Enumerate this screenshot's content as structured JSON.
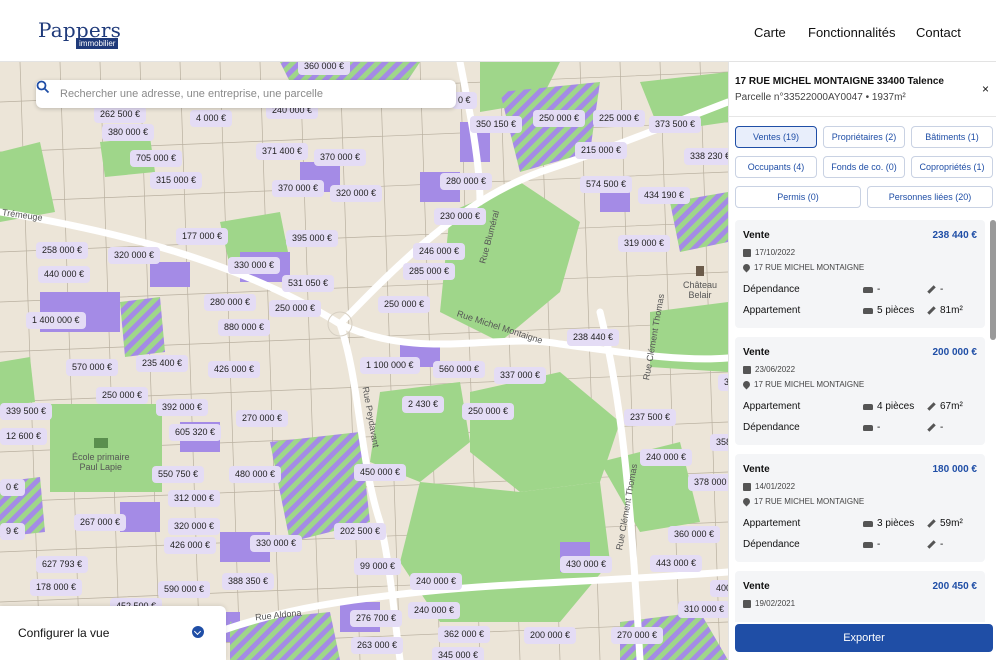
{
  "header": {
    "logo_main": "Pappers",
    "logo_sub": "immobilier",
    "nav": [
      {
        "label": "Carte"
      },
      {
        "label": "Fonctionnalités"
      },
      {
        "label": "Contact"
      }
    ]
  },
  "map": {
    "search_placeholder": "Rechercher une adresse, une entreprise, une parcelle",
    "configure_label": "Configurer la vue",
    "place_labels": [
      {
        "text": "École primaire\nPaul Lapie"
      },
      {
        "text": "Château Belair"
      }
    ],
    "street_labels": [
      {
        "text": "Rue Michel Montaigne"
      },
      {
        "text": "Rue Aldona"
      },
      {
        "text": "Rue Bluméral"
      },
      {
        "text": "Rue Clément Thomas"
      },
      {
        "text": "Rue Peydavant"
      },
      {
        "text": "Trémeuge"
      }
    ],
    "prices": [
      "360 000 €",
      "262 500 €",
      "240 000 €",
      "4 000 €",
      "380 000 €",
      "350 150 €",
      "250 000 €",
      "225 000 €",
      "373 500 €",
      "705 000 €",
      "371 400 €",
      "370 000 €",
      "215 000 €",
      "338 230 €",
      "315 000 €",
      "280 000 €",
      "574 500 €",
      "370 000 €",
      "320 000 €",
      "434 190 €",
      "230 000 €",
      "177 000 €",
      "395 000 €",
      "258 000 €",
      "320 000 €",
      "330 000 €",
      "246 000 €",
      "319 000 €",
      "440 000 €",
      "285 000 €",
      "531 050 €",
      "250 000 €",
      "280 000 €",
      "250 000 €",
      "1 400 000 €",
      "880 000 €",
      "238 440 €",
      "1 100 000 €",
      "570 000 €",
      "235 400 €",
      "426 000 €",
      "560 000 €",
      "337 000 €",
      "250 000 €",
      "392 000 €",
      "2 430 €",
      "250 000 €",
      "339 500 €",
      "270 000 €",
      "237 500 €",
      "12 600 €",
      "605 320 €",
      "240 000 €",
      "550 750 €",
      "480 000 €",
      "450 000 €",
      "378 000 €",
      "312 000 €",
      "267 000 €",
      "320 000 €",
      "426 000 €",
      "330 000 €",
      "202 500 €",
      "360 000 €",
      "627 793 €",
      "99 000 €",
      "430 000 €",
      "443 000 €",
      "178 000 €",
      "590 000 €",
      "388 350 €",
      "240 000 €",
      "452 500 €",
      "240 000 €",
      "276 700 €",
      "310 000 €",
      "362 000 €",
      "200 000 €",
      "270 000 €",
      "263 000 €",
      "345 000 €",
      "0 €",
      "358",
      "400",
      "3",
      "0 €",
      "9 €"
    ]
  },
  "panel": {
    "address": "17 RUE MICHEL MONTAIGNE 33400 Talence",
    "parcel": "Parcelle n°33522000AY0047 • 1937m²",
    "close_glyph": "×",
    "tabs": [
      {
        "label": "Ventes (19)",
        "active": true
      },
      {
        "label": "Propriétaires (2)"
      },
      {
        "label": "Bâtiments (1)"
      },
      {
        "label": "Occupants (4)"
      },
      {
        "label": "Fonds de co. (0)"
      },
      {
        "label": "Copropriétés (1)"
      },
      {
        "label": "Permis (0)"
      },
      {
        "label": "Personnes liées (20)"
      }
    ],
    "sales": [
      {
        "title": "Vente",
        "price": "238 440 €",
        "date": "17/10/2022",
        "address": "17 RUE MICHEL MONTAIGNE",
        "rows": [
          {
            "label": "Dépendance",
            "rooms": "-",
            "area": "-"
          },
          {
            "label": "Appartement",
            "rooms": "5 pièces",
            "area": "81m²"
          }
        ]
      },
      {
        "title": "Vente",
        "price": "200 000 €",
        "date": "23/06/2022",
        "address": "17 RUE MICHEL MONTAIGNE",
        "rows": [
          {
            "label": "Appartement",
            "rooms": "4 pièces",
            "area": "67m²"
          },
          {
            "label": "Dépendance",
            "rooms": "-",
            "area": "-"
          }
        ]
      },
      {
        "title": "Vente",
        "price": "180 000 €",
        "date": "14/01/2022",
        "address": "17 RUE MICHEL MONTAIGNE",
        "rows": [
          {
            "label": "Appartement",
            "rooms": "3 pièces",
            "area": "59m²"
          },
          {
            "label": "Dépendance",
            "rooms": "-",
            "area": "-"
          }
        ]
      },
      {
        "title": "Vente",
        "price": "200 450 €",
        "date": "19/02/2021",
        "address": "",
        "rows": []
      }
    ],
    "export_label": "Exporter"
  },
  "colors": {
    "brand": "#1f4ea6",
    "logo": "#1f3a7a",
    "green_area": "#9fd68a",
    "purple_parcel": "#a48be6",
    "price_tag": "#e4dcf5",
    "urban": "#ece5d8"
  }
}
